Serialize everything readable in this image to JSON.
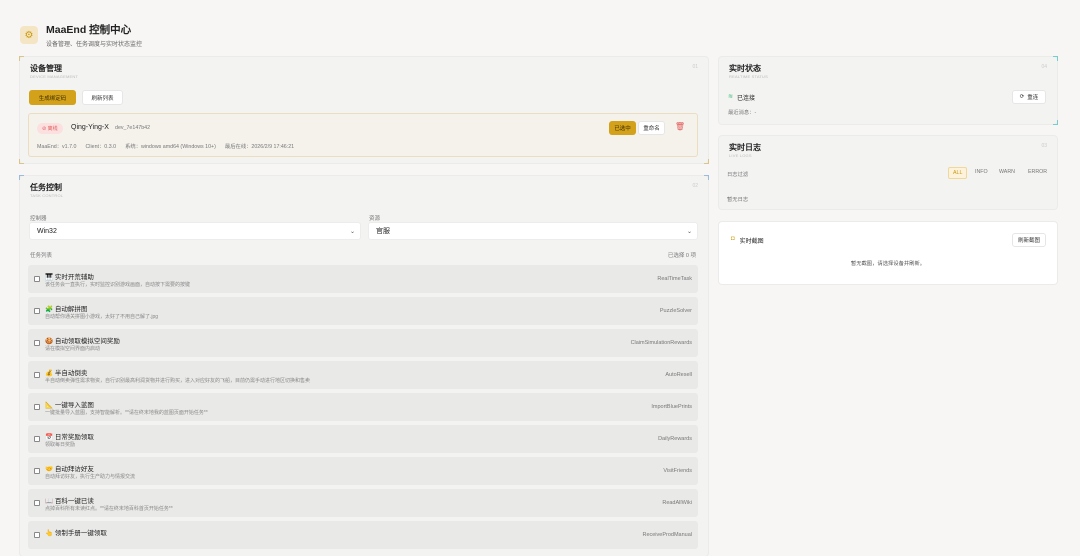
{
  "header": {
    "title": "MaaEnd 控制中心",
    "subtitle": "设备管理、任务调度与实时状态监控",
    "logo_icon": "puzzle-icon"
  },
  "device_panel": {
    "title": "设备管理",
    "subtitle": "DEVICE MANAGEMENT",
    "number": "01",
    "generate_button": "生成绑定码",
    "refresh_button": "刷新列表",
    "device": {
      "status": "离线",
      "name": "Qing-Ying-X",
      "id": "dev_7e147b42",
      "maaend": "MaaEnd：v1.7.0",
      "client": "Client：0.3.0",
      "system": "系统：windows amd64 (Windows 10+)",
      "last_online": "最后在线：2026/2/9 17:46:21",
      "selected_button": "已选中",
      "rename_button": "重命名"
    }
  },
  "task_panel": {
    "title": "任务控制",
    "subtitle": "TASK CONTROL",
    "number": "02",
    "controller_label": "控制器",
    "controller_value": "Win32",
    "resource_label": "资源",
    "resource_value": "官服",
    "list_label": "任务列表",
    "selected_count": "已选择 0 项",
    "tasks": [
      {
        "icon": "🎹",
        "name": "实时开荒辅助",
        "desc": "该任务会一直执行，实时监控识别游戏画面，自动按下需要的按键",
        "id": "RealTimeTask"
      },
      {
        "icon": "🧩",
        "name": "自动解拼图",
        "desc": "自动帮你通关拼图小游戏，太好了不用自己解了.jpg",
        "id": "PuzzleSolver"
      },
      {
        "icon": "🍪",
        "name": "自动领取模拟空间奖励",
        "desc": "请在模拟空间界面内启动",
        "id": "ClaimSimulationRewards"
      },
      {
        "icon": "💰",
        "name": "半自动倒卖",
        "desc": "半自动倒卖弹性需求物资，自行识别最高利润货物并进行购买，进入对应好友的飞船，目前仍需手动进行地区切换和售卖",
        "id": "AutoResell"
      },
      {
        "icon": "📐",
        "name": "一键导入蓝图",
        "desc": "一键批量导入蓝图，支持智能解析。**请在终末地我的蓝图页面开始任务**",
        "id": "ImportBluePrints"
      },
      {
        "icon": "📅",
        "name": "日常奖励领取",
        "desc": "领取每日奖励",
        "id": "DailyRewards"
      },
      {
        "icon": "🤝",
        "name": "自动拜访好友",
        "desc": "自动拜访好友，执行生产助力与情报交流",
        "id": "VisitFriends"
      },
      {
        "icon": "📖",
        "name": "百科一键已读",
        "desc": "点掉百科所有未读红点。**请在终末地百科首页开始任务**",
        "id": "ReadAllWiki"
      },
      {
        "icon": "👆",
        "name": "领制手册一键领取",
        "desc": "",
        "id": "ReceiveProdManual"
      }
    ]
  },
  "status_panel": {
    "title": "实时状态",
    "subtitle": "REALTIME STATUS",
    "number": "04",
    "connection": "已连接",
    "last_message": "最近消息：-",
    "reconnect_button": "重连"
  },
  "log_panel": {
    "title": "实时日志",
    "subtitle": "LIVE LOGS",
    "number": "03",
    "filter_label": "日志过滤",
    "filters": [
      "ALL",
      "INFO",
      "WARN",
      "ERROR"
    ],
    "empty": "暂无日志"
  },
  "screenshot_panel": {
    "title": "实时截图",
    "refresh_button": "刷新截图",
    "empty": "暂无截图，请选择设备并刷新。"
  },
  "colors": {
    "accent": "#d4a21a",
    "offline": "#e05a5a",
    "connected": "#3dbb7a"
  }
}
